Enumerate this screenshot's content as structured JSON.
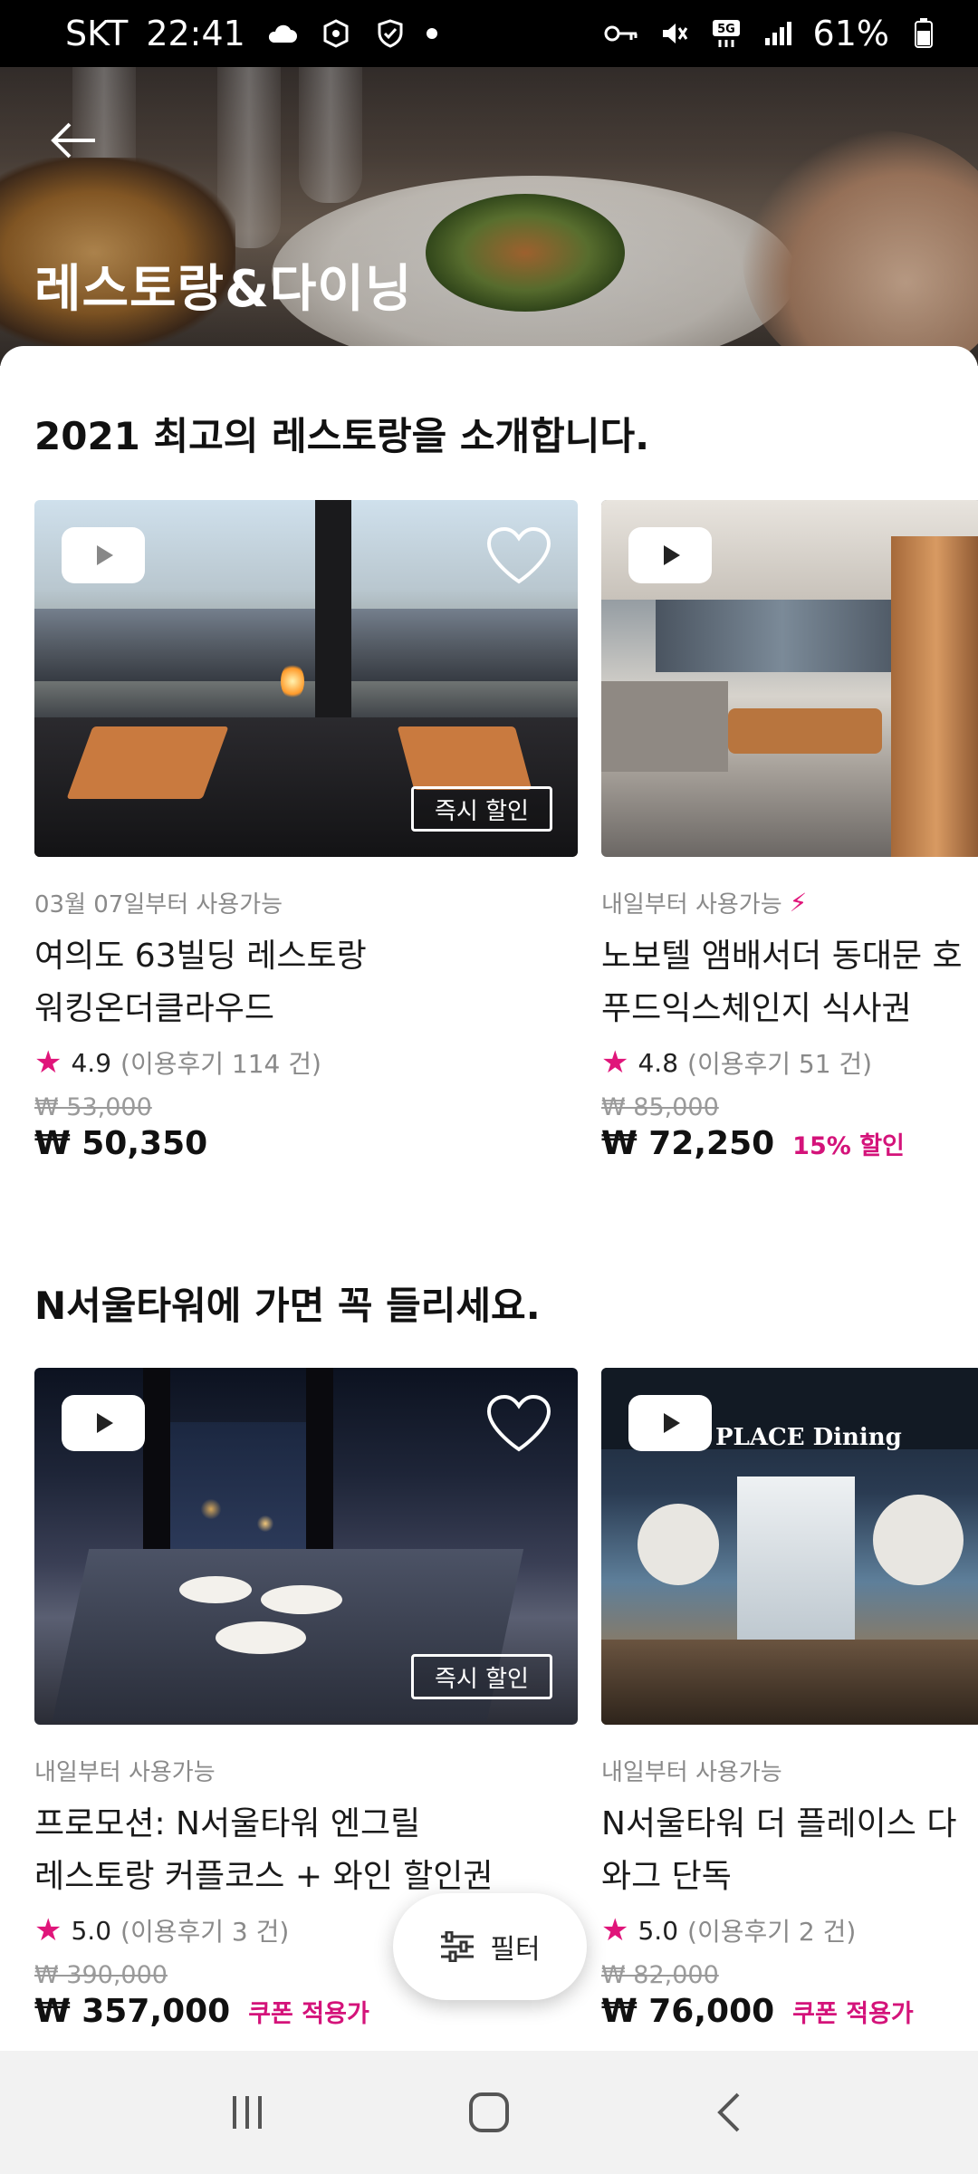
{
  "status_bar": {
    "carrier": "SKT",
    "time": "22:41",
    "battery": "61%",
    "icons": [
      "cloud-icon",
      "package-icon",
      "shield-check-icon",
      "notification-dot",
      "key-icon",
      "mute-icon",
      "5g-icon",
      "signal-icon",
      "battery-icon"
    ]
  },
  "header": {
    "title": "레스토랑&다이닝",
    "back_icon": "back-arrow-icon"
  },
  "sections": [
    {
      "title": "2021 최고의 레스토랑을 소개합니다.",
      "cards": [
        {
          "availability": "03월 07일부터 사용가능",
          "name_line1": "여의도 63빌딩 레스토랑",
          "name_line2": "워킹온더클라우드",
          "rating": "4.9",
          "reviews": "(이용후기 114 건)",
          "original_price": "₩ 53,000",
          "price": "₩ 50,350",
          "discount": "",
          "badge": "즉시 할인",
          "favorite": false
        },
        {
          "availability": "내일부터 사용가능",
          "name_line1": "노보텔 앰배서더 동대문 호",
          "name_line2": "푸드익스체인지 식사권",
          "rating": "4.8",
          "reviews": "(이용후기 51 건)",
          "original_price": "₩ 85,000",
          "price": "₩ 72,250",
          "discount": "15% 할인"
        }
      ]
    },
    {
      "title": "N서울타워에 가면 꼭 들리세요.",
      "cards": [
        {
          "availability": "내일부터 사용가능",
          "name_line1": "프로모션: N서울타워 엔그릴",
          "name_line2": "레스토랑 커플코스 + 와인 할인권",
          "rating": "5.0",
          "reviews": "(이용후기 3 건)",
          "original_price": "₩ 390,000",
          "price": "₩ 357,000",
          "discount": "쿠폰 적용가",
          "badge": "즉시 할인",
          "favorite": false
        },
        {
          "availability": "내일부터 사용가능",
          "name_line1": "N서울타워 더 플레이스 다",
          "name_line2": "와그 단독",
          "rating": "5.0",
          "reviews": "(이용후기 2 건)",
          "original_price": "₩ 82,000",
          "price": "₩ 76,000",
          "discount": "쿠폰 적용가",
          "image_sign": "PLACE Dining"
        }
      ]
    }
  ],
  "filter": {
    "label": "필터",
    "icon": "sliders-icon"
  },
  "nav": {
    "icons": [
      "recent-apps-icon",
      "home-icon",
      "back-icon"
    ]
  },
  "colors": {
    "accent": "#e0157a",
    "text": "#111111",
    "muted": "#8a8a8a"
  }
}
